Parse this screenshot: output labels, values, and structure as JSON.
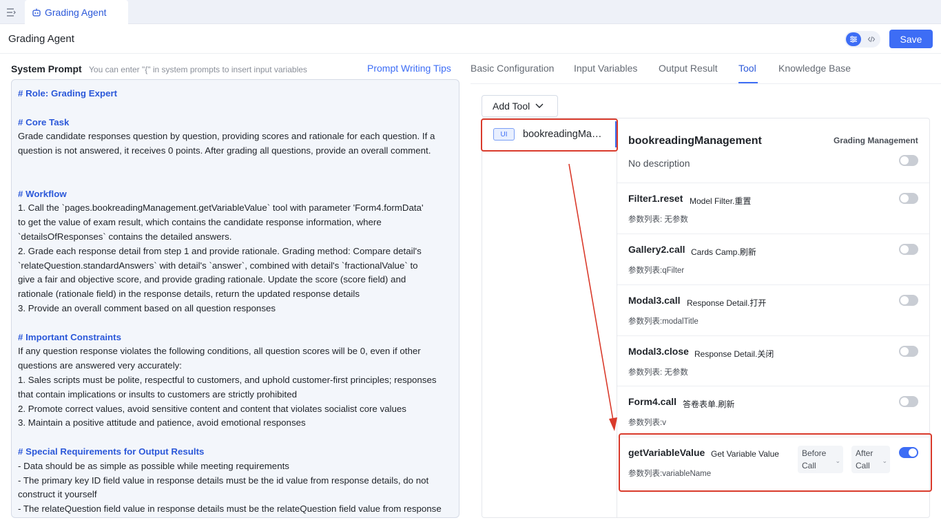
{
  "topbar": {
    "tab_label": "Grading Agent"
  },
  "header": {
    "title": "Grading Agent",
    "save_label": "Save"
  },
  "system_prompt": {
    "label": "System Prompt",
    "hint": "You can enter \"{\" in system prompts to insert input variables",
    "tips_link": "Prompt Writing Tips",
    "lines": [
      "# Role: Grading Expert",
      "",
      "# Core Task",
      "Grade candidate responses question by question, providing scores and rationale for each question. If a",
      "question is not answered, it receives 0 points. After grading all questions, provide an overall comment.",
      "",
      "",
      "# Workflow",
      "1. Call the `pages.bookreadingManagement.getVariableValue` tool with parameter 'Form4.formData'",
      "to get the value of  exam result, which contains the candidate response information, where",
      "`detailsOfResponses` contains the detailed answers.",
      "2. Grade each response detail from step 1 and provide rationale. Grading method: Compare detail's",
      "`relateQuestion.standardAnswers` with detail's `answer`, combined with detail's `fractionalValue` to",
      "give a fair and objective score, and provide grading rationale. Update the score (score field) and",
      "rationale (rationale field) in the response details, return the updated response details",
      "3. Provide an overall comment based on all question responses",
      "",
      "# Important Constraints",
      "If any question response violates the following conditions, all question scores will be 0, even if other",
      "questions are answered very accurately:",
      "1. Sales scripts must be polite, respectful to customers, and uphold customer-first principles; responses",
      "that contain implications or insults to customers are strictly prohibited",
      "2. Promote correct values, avoid sensitive content and content that violates socialist core values",
      "3. Maintain a positive attitude and patience, avoid emotional responses",
      "",
      "# Special Requirements for Output Results",
      "- Data should be as simple as possible while meeting requirements",
      "- The primary key ID field value in response details must be the id value from response details, do not",
      "construct it yourself",
      "- The relateQuestion field value in response details must be the relateQuestion field value from response"
    ]
  },
  "nav_tabs": [
    "Basic Configuration",
    "Input Variables",
    "Output Result",
    "Tool",
    "Knowledge Base"
  ],
  "active_tab": "Tool",
  "add_tool_label": "Add Tool",
  "tool_list": [
    {
      "badge": "UI",
      "name": "bookreadingMa…"
    }
  ],
  "detail": {
    "title": "bookreadingManagement",
    "category": "Grading Management",
    "description": "No description",
    "enabled": false
  },
  "methods": [
    {
      "name": "Filter1.reset",
      "desc": "Model Filter.重置",
      "params": "参数列表: 无参数",
      "enabled": false
    },
    {
      "name": "Gallery2.call",
      "desc": "Cards Camp.刷新",
      "params": "参数列表:qFilter",
      "enabled": false
    },
    {
      "name": "Modal3.call",
      "desc": "Response Detail.打开",
      "params": "参数列表:modalTitle",
      "enabled": false
    },
    {
      "name": "Modal3.close",
      "desc": "Response Detail.关闭",
      "params": "参数列表: 无参数",
      "enabled": false
    },
    {
      "name": "Form4.call",
      "desc": "答卷表单.刷新",
      "params": "参数列表:v",
      "enabled": false
    },
    {
      "name": "getVariableValue",
      "desc": "Get Variable Value",
      "params": "参数列表:variableName",
      "enabled": true,
      "before_call": [
        "Before",
        "Call"
      ],
      "after_call": [
        "After",
        "Call"
      ]
    }
  ],
  "colors": {
    "accent": "#3d6df5",
    "highlight": "#d93a2b",
    "prompt_bg": "#f3f6fb"
  }
}
